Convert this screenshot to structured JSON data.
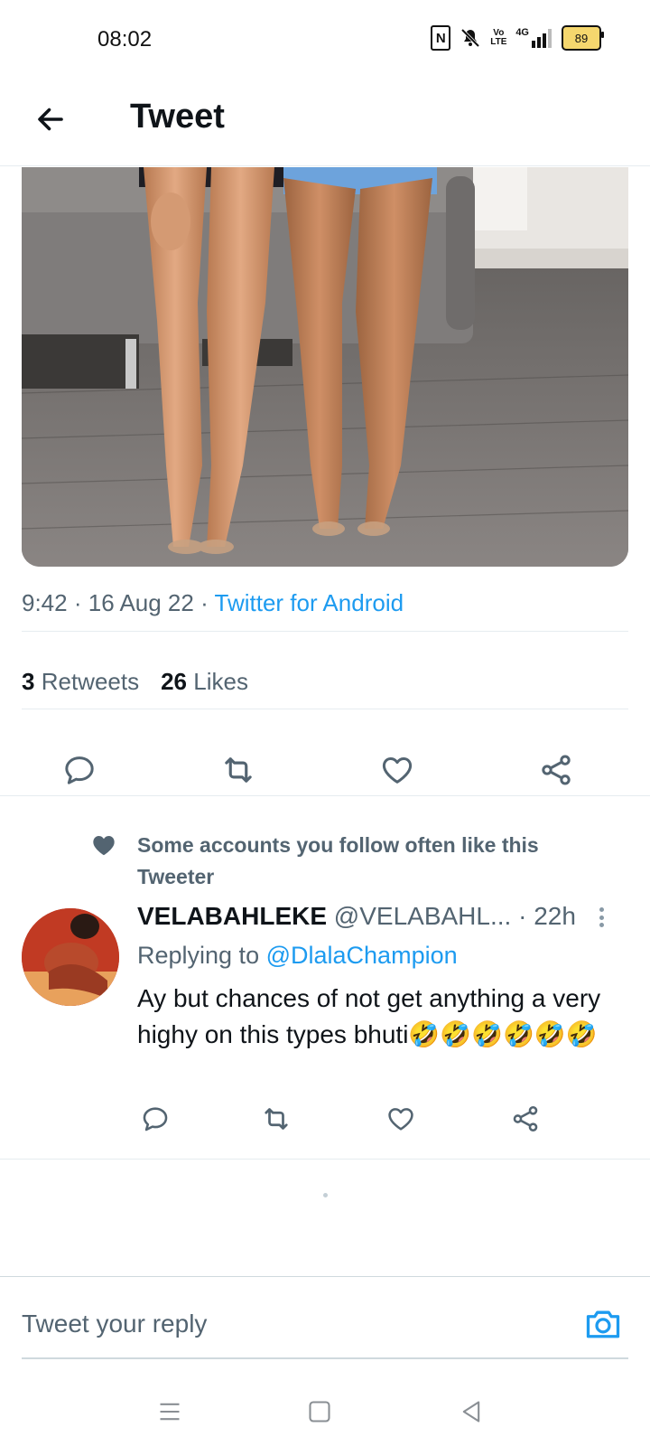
{
  "status_bar": {
    "time": "08:02",
    "icons": [
      "nfc-icon",
      "silent-icon",
      "volte-icon",
      "signal-4g-icon"
    ],
    "volte_label_top": "Vo",
    "volte_label_bottom": "LTE",
    "network": "4G",
    "battery": "89"
  },
  "header": {
    "title": "Tweet",
    "back_icon": "arrow-left-icon"
  },
  "tweet": {
    "time": "9:42",
    "date": "16 Aug 22",
    "source": "Twitter for Android",
    "retweets_count": "3",
    "retweets_label": "Retweets",
    "likes_count": "26",
    "likes_label": "Likes",
    "actions": [
      "reply-icon",
      "retweet-icon",
      "like-icon",
      "share-icon"
    ]
  },
  "social_context": {
    "text": "Some accounts you follow often like this Tweeter"
  },
  "reply": {
    "display_name": "VELABAHLEKE",
    "handle": "@VELABAHL...",
    "time": "22h",
    "replying_prefix": "Replying to",
    "replying_to": "@DlalaChampion",
    "text": "Ay but chances  of not get anything a very highy on this types bhuti🤣🤣🤣🤣🤣🤣"
  },
  "compose": {
    "placeholder": "Tweet your reply"
  },
  "navbar": {
    "icons": [
      "menu-icon",
      "home-square-icon",
      "back-triangle-icon"
    ]
  },
  "colors": {
    "accent": "#1d9bf0",
    "secondary_text": "#536471",
    "primary_text": "#0f1419",
    "divider": "#e6ecf0"
  }
}
